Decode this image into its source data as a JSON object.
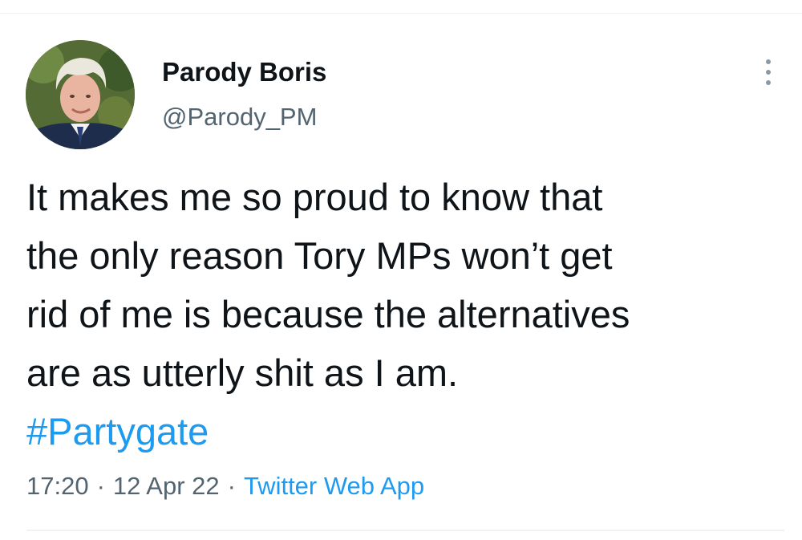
{
  "tweet": {
    "display_name": "Parody Boris",
    "handle": "@Parody_PM",
    "avatar_icon": "profile-photo",
    "more_icon": "more-vertical-icon",
    "text_lines": [
      "It makes me so proud to know that",
      "the only reason Tory MPs won’t get",
      "rid of me is because the alternatives",
      "are as utterly shit as I am."
    ],
    "hashtag": "#Partygate",
    "time": "17:20",
    "separator": "·",
    "date": "12 Apr 22",
    "source": "Twitter Web App"
  },
  "colors": {
    "text": "#0f1419",
    "secondary": "#536471",
    "link": "#1d9bf0",
    "divider": "#eff3f4"
  }
}
